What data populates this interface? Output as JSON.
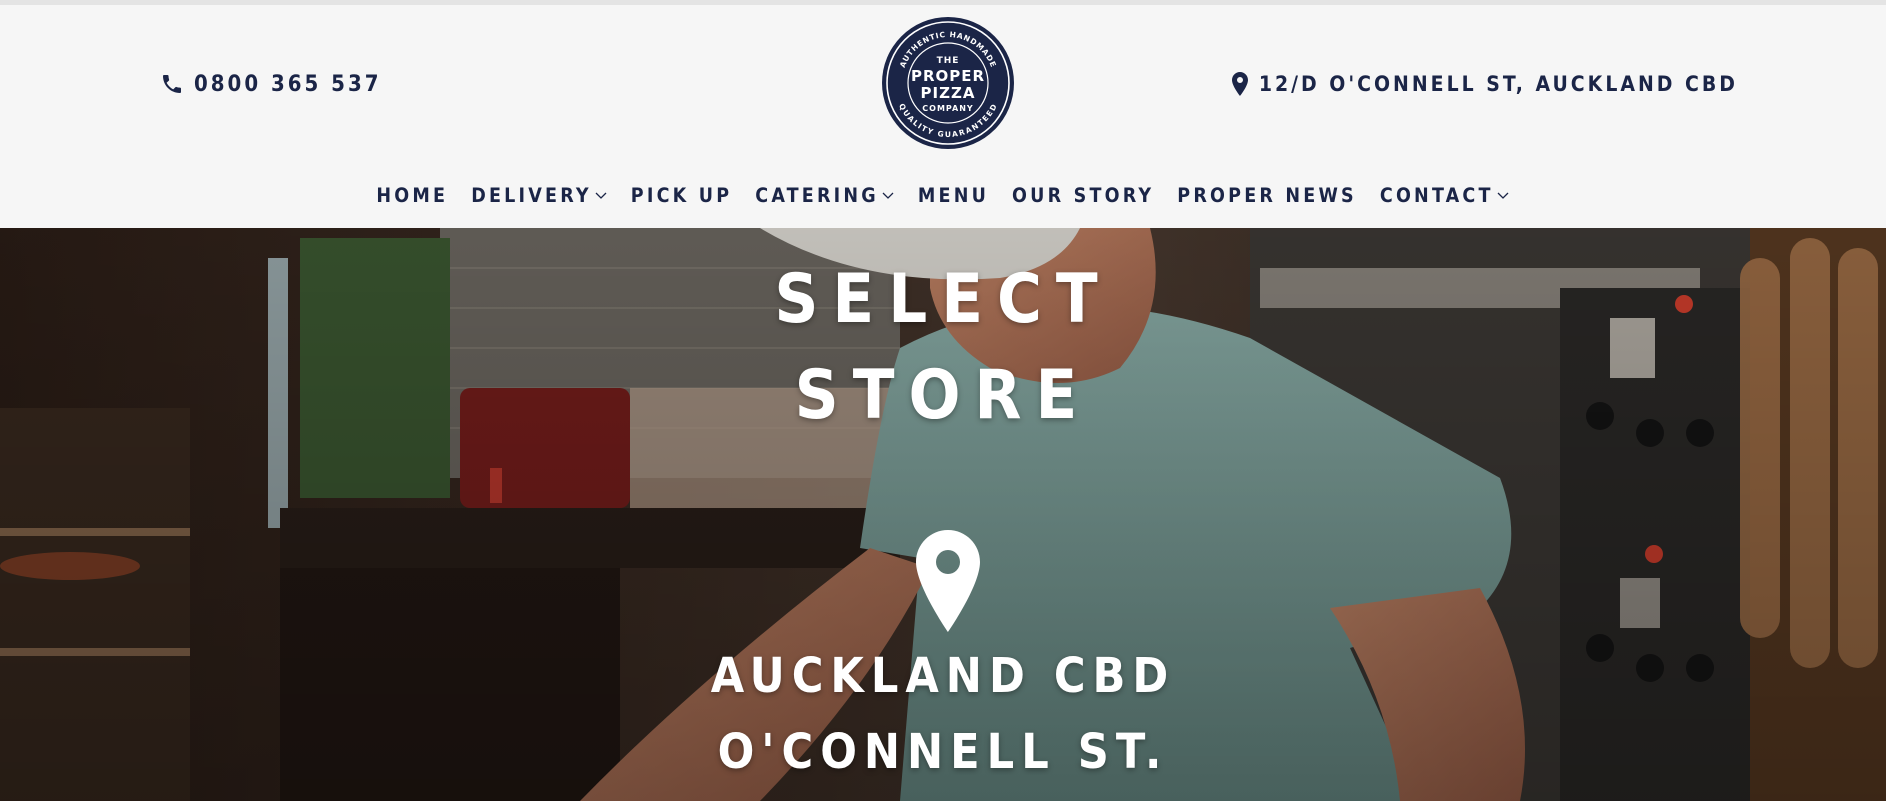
{
  "header": {
    "phone": "0800 365 537",
    "address": "12/D O'CONNELL ST, AUCKLAND CBD",
    "logo": {
      "top_arc": "AUTHENTIC HANDMADE",
      "line1": "THE",
      "line2": "PROPER",
      "line3": "PIZZA",
      "line4": "COMPANY",
      "bottom_arc": "QUALITY GUARANTEED"
    }
  },
  "nav": [
    {
      "label": "HOME"
    },
    {
      "label": "DELIVERY"
    },
    {
      "label": "PICK UP"
    },
    {
      "label": "CATERING"
    },
    {
      "label": "MENU"
    },
    {
      "label": "OUR STORY"
    },
    {
      "label": "PROPER NEWS"
    },
    {
      "label": "CONTACT"
    }
  ],
  "hero": {
    "title_line1": "SELECT",
    "title_line2": "STORE",
    "store_line1": "AUCKLAND CBD",
    "store_line2": "O'CONNELL ST."
  },
  "colors": {
    "navy": "#1b2547",
    "header_bg": "#f6f6f6",
    "hero_text": "#ffffff"
  },
  "icons": {
    "phone": "phone-icon",
    "address": "map-pin-icon",
    "store": "map-pin-icon",
    "dropdown": "chevron-down-icon"
  }
}
